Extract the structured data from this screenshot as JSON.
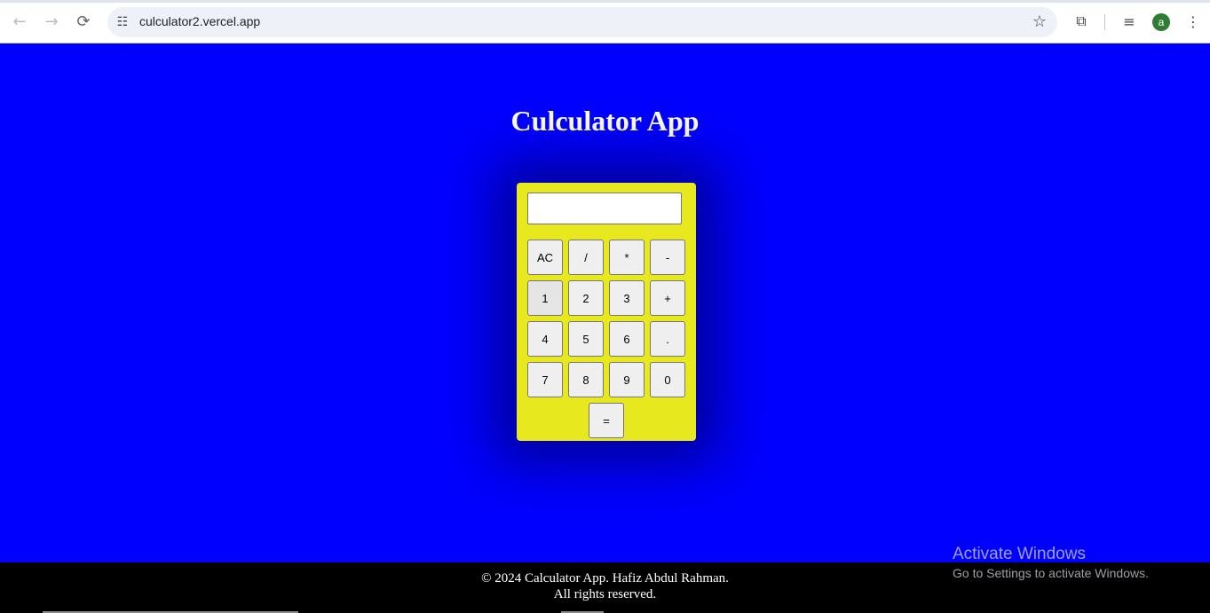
{
  "browser": {
    "url": "culculator2.vercel.app",
    "back_icon": "←",
    "forward_icon": "→",
    "reload_icon": "⟳",
    "site_info_icon": "☷",
    "star_icon": "☆",
    "extensions_icon": "⧉",
    "media_icon": "≡",
    "avatar_letter": "a",
    "menu_icon": "⋮"
  },
  "page": {
    "title": "Culculator App",
    "background_color": "#0000ff"
  },
  "calculator": {
    "body_color": "#e8e81e",
    "display_value": "",
    "keys": [
      {
        "label": "AC"
      },
      {
        "label": "/"
      },
      {
        "label": "*"
      },
      {
        "label": "-"
      },
      {
        "label": "1"
      },
      {
        "label": "2"
      },
      {
        "label": "3"
      },
      {
        "label": "+"
      },
      {
        "label": "4"
      },
      {
        "label": "5"
      },
      {
        "label": "6"
      },
      {
        "label": "."
      },
      {
        "label": "7"
      },
      {
        "label": "8"
      },
      {
        "label": "9"
      },
      {
        "label": "0"
      },
      {
        "label": "="
      }
    ]
  },
  "footer": {
    "line1": "© 2024 Calculator App. Hafiz Abdul Rahman.",
    "line2": "All rights reserved."
  },
  "watermark": {
    "title": "Activate Windows",
    "subtitle": "Go to Settings to activate Windows."
  }
}
